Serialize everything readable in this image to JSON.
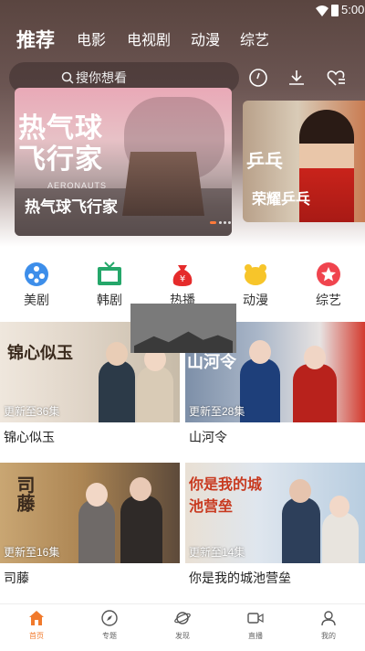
{
  "status_bar": {
    "time": "5:00"
  },
  "top_tabs": [
    {
      "label": "推荐",
      "active": true
    },
    {
      "label": "电影"
    },
    {
      "label": "电视剧"
    },
    {
      "label": "动漫"
    },
    {
      "label": "综艺"
    }
  ],
  "search": {
    "placeholder": "搜你想看"
  },
  "header_icons": [
    "history-icon",
    "download-icon",
    "heart-list-icon"
  ],
  "banners": [
    {
      "caption": "热气球飞行家",
      "logo": "热气球\n飞行家",
      "logo_sub": "AERONAUTS"
    },
    {
      "caption": "荣耀乒乓",
      "logo": "乒乓"
    }
  ],
  "categories": [
    {
      "label": "美剧",
      "icon": "film-reel-icon",
      "color": "#3d8eea"
    },
    {
      "label": "韩剧",
      "icon": "tv-icon",
      "color": "#25a76a"
    },
    {
      "label": "热播",
      "icon": "money-bag-icon",
      "color": "#e52b2b"
    },
    {
      "label": "动漫",
      "icon": "bear-icon",
      "color": "#f7c52a"
    },
    {
      "label": "综艺",
      "icon": "star-icon",
      "color": "#f0444e"
    }
  ],
  "posters": [
    {
      "title": "锦心似玉",
      "episode": "更新至36集",
      "art": "锦心似玉"
    },
    {
      "title": "山河令",
      "episode": "更新至28集",
      "art": "山河令"
    },
    {
      "title": "司藤",
      "episode": "更新至16集",
      "art": "司藤"
    },
    {
      "title": "你是我的城池营垒",
      "episode": "更新至14集",
      "art": "你是我的城池营垒"
    }
  ],
  "bottom_nav": [
    {
      "label": "首页",
      "icon": "home-icon",
      "active": true
    },
    {
      "label": "专题",
      "icon": "compass-icon"
    },
    {
      "label": "发现",
      "icon": "planet-icon"
    },
    {
      "label": "直播",
      "icon": "video-camera-icon"
    },
    {
      "label": "我的",
      "icon": "user-icon"
    }
  ],
  "colors": {
    "accent": "#f17a2c",
    "status_text": "#ffffff"
  }
}
